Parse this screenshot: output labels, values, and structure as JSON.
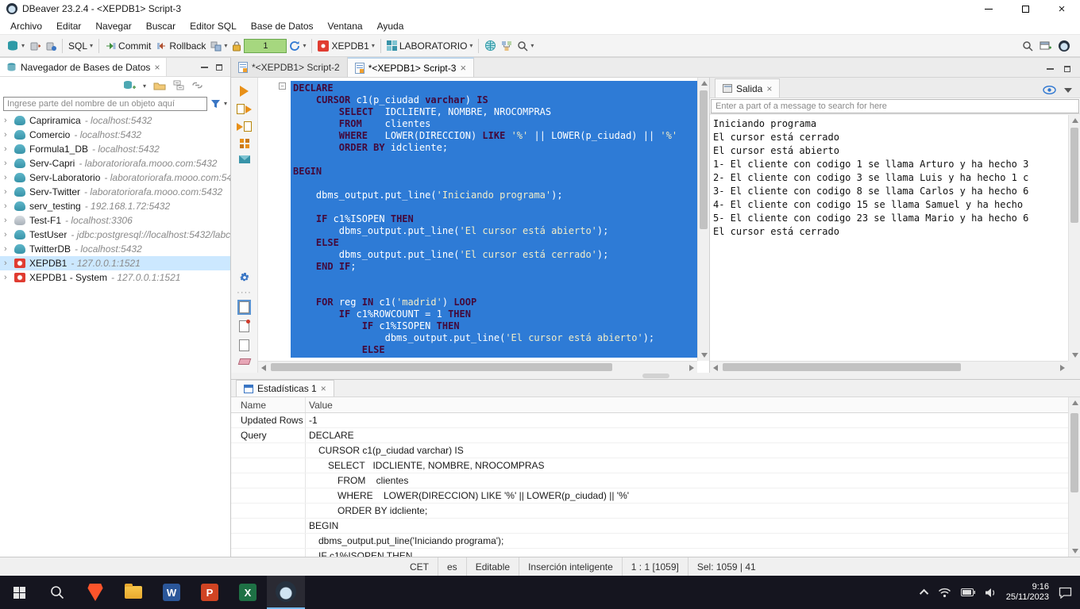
{
  "window": {
    "title": "DBeaver 23.2.4 - <XEPDB1> Script-3"
  },
  "icons": {
    "caret": "▾",
    "expander": "›",
    "close": "×",
    "fold": "−",
    "dots": "····"
  },
  "colors": {
    "selection_blue": "#2e7bd6",
    "keyword": "#43093a",
    "str_color": "#f0ecc8",
    "oracle_red": "#e03c31",
    "pg_teal": "#3793a8",
    "maria_gray": "#a8b0b8",
    "accent_blue": "#2f77d1",
    "green_counter_bg": "#a6d77f",
    "green_counter_border": "#6aa84f",
    "taskbar_bg": "#15151f",
    "word_blue": "#2b579a",
    "ppt_orange": "#d04423",
    "excel_green": "#1e7145",
    "brave_orange": "#fb542b",
    "folder_yellow": "#f7c64a"
  },
  "menu": {
    "items": [
      "Archivo",
      "Editar",
      "Navegar",
      "Buscar",
      "Editor SQL",
      "Base de Datos",
      "Ventana",
      "Ayuda"
    ]
  },
  "toolbar": {
    "sql_label": "SQL",
    "commit_label": "Commit",
    "rollback_label": "Rollback",
    "tx_count": "1",
    "connection": "XEPDB1",
    "schema": "LABORATORIO"
  },
  "navigator": {
    "title": "Navegador de Bases de Datos",
    "filter_placeholder": "Ingrese parte del nombre de un objeto aquí",
    "items": [
      {
        "name": "Capriramica",
        "host": "localhost:5432",
        "icon": "pg"
      },
      {
        "name": "Comercio",
        "host": "localhost:5432",
        "icon": "pg"
      },
      {
        "name": "Formula1_DB",
        "host": "localhost:5432",
        "icon": "pg"
      },
      {
        "name": "Serv-Capri",
        "host": "laboratoriorafa.mooo.com:5432",
        "icon": "pg"
      },
      {
        "name": "Serv-Laboratorio",
        "host": "laboratoriorafa.mooo.com:54",
        "icon": "pg"
      },
      {
        "name": "Serv-Twitter",
        "host": "laboratoriorafa.mooo.com:5432",
        "icon": "pg"
      },
      {
        "name": "serv_testing",
        "host": "192.168.1.72:5432",
        "icon": "pg"
      },
      {
        "name": "Test-F1",
        "host": "localhost:3306",
        "icon": "maria"
      },
      {
        "name": "TestUser",
        "host": "jdbc:postgresql://localhost:5432/labc",
        "icon": "pg"
      },
      {
        "name": "TwitterDB",
        "host": "localhost:5432",
        "icon": "pg"
      },
      {
        "name": "XEPDB1",
        "host": "127.0.0.1:1521",
        "icon": "oracle",
        "selected": "selected"
      },
      {
        "name": "XEPDB1 - System",
        "host": "127.0.0.1:1521",
        "icon": "oracle"
      }
    ]
  },
  "editor": {
    "tabs": [
      {
        "label": "*<XEPDB1> Script-2"
      },
      {
        "label": "*<XEPDB1> Script-3",
        "active": "active"
      }
    ],
    "code_lines": [
      "DECLARE",
      "    CURSOR c1(p_ciudad varchar) IS",
      "        SELECT  IDCLIENTE, NOMBRE, NROCOMPRAS",
      "        FROM    clientes",
      "        WHERE   LOWER(DIRECCION) LIKE '%' || LOWER(p_ciudad) || '%'",
      "        ORDER BY idcliente;",
      "",
      "BEGIN",
      "",
      "    dbms_output.put_line('Iniciando programa');",
      "",
      "    IF c1%ISOPEN THEN",
      "        dbms_output.put_line('El cursor está abierto');",
      "    ELSE",
      "        dbms_output.put_line('El cursor está cerrado');",
      "    END IF;",
      "",
      "",
      "    FOR reg IN c1('madrid') LOOP",
      "        IF c1%ROWCOUNT = 1 THEN",
      "            IF c1%ISOPEN THEN",
      "                dbms_output.put_line('El cursor está abierto');",
      "            ELSE"
    ]
  },
  "output": {
    "tab": "Salida",
    "search_placeholder": "Enter a part of a message to search for here",
    "lines": [
      "Iniciando programa",
      "El cursor está cerrado",
      "El cursor está abierto",
      "1- El cliente con codigo 1 se llama Arturo y ha hecho 3",
      "2- El cliente con codigo 3 se llama Luis y ha hecho 1 c",
      "3- El cliente con codigo 8 se llama Carlos y ha hecho 6",
      "4- El cliente con codigo 15 se llama Samuel y ha hecho",
      "5- El cliente con codigo 23 se llama Mario y ha hecho 6",
      "El cursor está cerrado"
    ]
  },
  "stats": {
    "tab": "Estadísticas 1",
    "columns": {
      "name": "Name",
      "value": "Value"
    },
    "rows": [
      {
        "name": "Updated Rows",
        "value": "-1",
        "indent": 0
      },
      {
        "name": "Query",
        "value": "DECLARE",
        "indent": 0
      },
      {
        "name": "",
        "value": "CURSOR c1(p_ciudad varchar) IS",
        "indent": 1
      },
      {
        "name": "",
        "value": "SELECT   IDCLIENTE, NOMBRE, NROCOMPRAS",
        "indent": 2
      },
      {
        "name": "",
        "value": "FROM    clientes",
        "indent": 3
      },
      {
        "name": "",
        "value": "WHERE    LOWER(DIRECCION) LIKE '%' || LOWER(p_ciudad) || '%'",
        "indent": 3
      },
      {
        "name": "",
        "value": "ORDER BY idcliente;",
        "indent": 3
      },
      {
        "name": "",
        "value": "BEGIN",
        "indent": 0
      },
      {
        "name": "",
        "value": "dbms_output.put_line('Iniciando programa');",
        "indent": 1
      },
      {
        "name": "",
        "value": "IF c1%ISOPEN THEN",
        "indent": 1
      }
    ]
  },
  "statusbar": {
    "items": [
      "CET",
      "es",
      "Editable",
      "Inserción inteligente",
      "1 : 1 [1059]",
      "Sel: 1059 | 41"
    ]
  },
  "taskbar": {
    "word_letter": "W",
    "ppt_letter": "P",
    "excel_letter": "X",
    "time": "9:16",
    "date": "25/11/2023"
  }
}
